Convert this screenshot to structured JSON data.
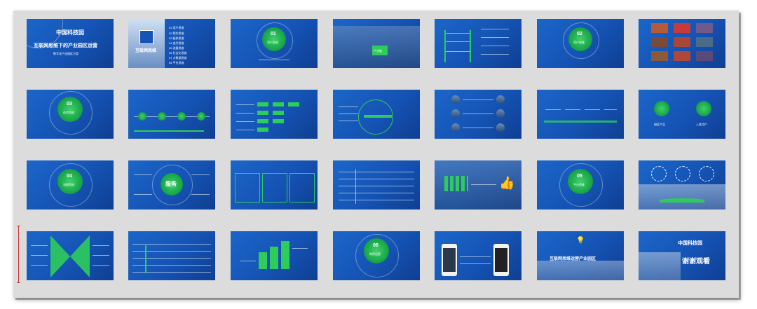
{
  "slides": [
    {
      "num": "1",
      "title": "互联网思维下的产业园区运营",
      "logo": "中国科技园",
      "sub": "数字化产业园区方案"
    },
    {
      "num": "2",
      "title": "互联网思维",
      "items": [
        "01 用户思维",
        "02 简约思维",
        "03 极致思维",
        "04 迭代思维",
        "05 流量思维",
        "06 社会化思维",
        "07 大数据思维",
        "08 平台思维"
      ]
    },
    {
      "num": "3",
      "badge": "01",
      "badge_label": "用户思维"
    },
    {
      "num": "4",
      "label": "产业链"
    },
    {
      "num": "5"
    },
    {
      "num": "6",
      "badge": "02",
      "badge_label": "用户思维"
    },
    {
      "num": "7"
    },
    {
      "num": "8",
      "badge": "03",
      "badge_label": "迭代思维"
    },
    {
      "num": "9"
    },
    {
      "num": "10"
    },
    {
      "num": "11"
    },
    {
      "num": "12"
    },
    {
      "num": "13"
    },
    {
      "num": "14",
      "labels": [
        "园区产品",
        "入驻用户"
      ]
    },
    {
      "num": "15",
      "badge": "04",
      "badge_label": "流量思维"
    },
    {
      "num": "16",
      "center": "服务"
    },
    {
      "num": "17"
    },
    {
      "num": "18"
    },
    {
      "num": "19"
    },
    {
      "num": "20",
      "badge": "05",
      "badge_label": "平台思维"
    },
    {
      "num": "21"
    },
    {
      "num": "22"
    },
    {
      "num": "23"
    },
    {
      "num": "24"
    },
    {
      "num": "25",
      "badge": "06",
      "badge_label": "跨界运营"
    },
    {
      "num": "26"
    },
    {
      "num": "27",
      "title": "互联网思维运营产业园区"
    },
    {
      "num": "28",
      "title": "谢谢观看",
      "logo": "中国科技园"
    }
  ],
  "colors": {
    "slide_blue": "#1553b4",
    "accent_green": "#2ecc5a",
    "selection": "#d9302c"
  }
}
